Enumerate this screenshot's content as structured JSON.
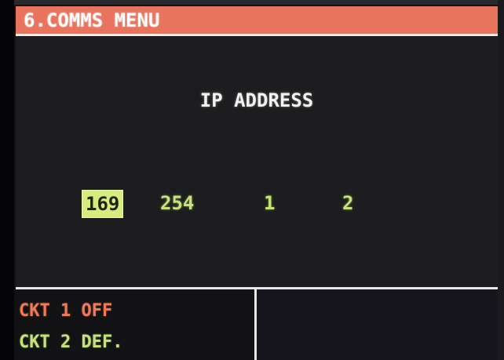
{
  "header": {
    "title": "6.COMMS MENU"
  },
  "main": {
    "title": "IP ADDRESS",
    "ip_octets": [
      "169",
      "254",
      "1",
      "2"
    ],
    "selected_octet_index": 0
  },
  "status": {
    "line1": "CKT 1 OFF",
    "line2": "CKT 2 DEF."
  },
  "colors": {
    "title_bar": "#e8745e",
    "value_green": "#c7e27a",
    "status_orange": "#f07a58",
    "selection_highlight": "#d7ec7e"
  }
}
